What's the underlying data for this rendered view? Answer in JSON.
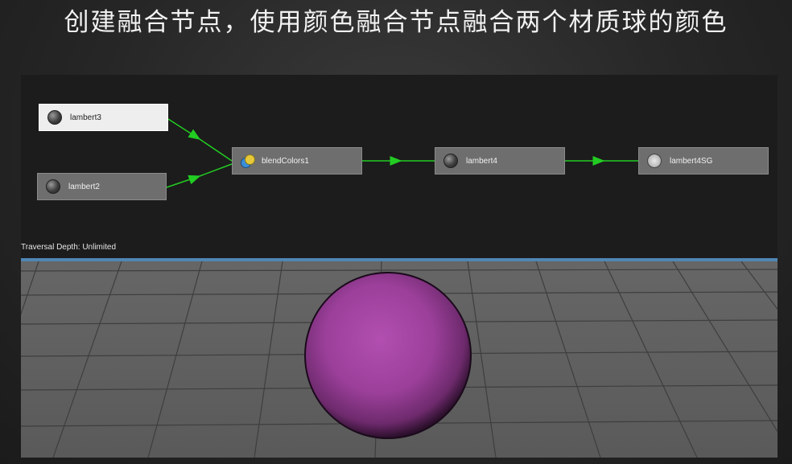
{
  "slide": {
    "title": "创建融合节点，使用颜色融合节点融合两个材质球的颜色"
  },
  "hypershade": {
    "nodes": [
      {
        "id": "lambert3",
        "label": "lambert3",
        "icon": "material-sphere-icon",
        "selected": true
      },
      {
        "id": "lambert2",
        "label": "lambert2",
        "icon": "material-sphere-icon",
        "selected": false
      },
      {
        "id": "blendColors1",
        "label": "blendColors1",
        "icon": "blend-colors-icon",
        "selected": false
      },
      {
        "id": "lambert4",
        "label": "lambert4",
        "icon": "material-sphere-icon",
        "selected": false
      },
      {
        "id": "lambert4SG",
        "label": "lambert4SG",
        "icon": "shading-group-icon",
        "selected": false
      }
    ],
    "connections": [
      [
        "lambert3",
        "blendColors1"
      ],
      [
        "lambert2",
        "blendColors1"
      ],
      [
        "blendColors1",
        "lambert4"
      ],
      [
        "lambert4",
        "lambert4SG"
      ]
    ],
    "traversal_depth": "Traversal Depth: Unlimited",
    "colors": {
      "wire": "#22cc22",
      "node": "#6e6e6e",
      "node_selected": "#eeeeee"
    }
  },
  "viewport": {
    "sphere_color": "#9b3f9a",
    "ground_color": "#5f5f5f",
    "grid_color": "#3e3e3e"
  }
}
